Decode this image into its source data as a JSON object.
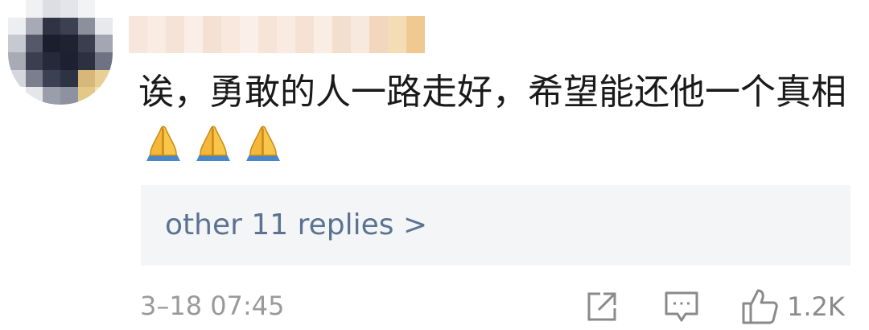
{
  "comment": {
    "text": "诶，勇敢的人一路走好，希望能还他一个真相",
    "emoji_name": "folded-hands-emoji",
    "emoji_count": 3,
    "replies_link": "other 11 replies >",
    "timestamp": "3–18 07:45",
    "like_count": "1.2K"
  },
  "icons": {
    "share": "share-icon",
    "comment": "comment-icon",
    "like": "thumbs-up-icon"
  },
  "colors": {
    "link": "#5b7393",
    "meta_text": "#9a9a9a",
    "reply_box_bg": "#f4f5f7",
    "icon": "#8a8a8a"
  }
}
